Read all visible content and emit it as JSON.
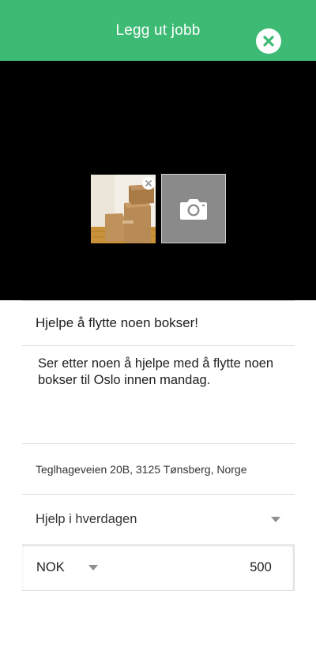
{
  "header": {
    "title": "Legg ut jobb",
    "background_color": "#3dba73",
    "close_icon": "close-circle-icon"
  },
  "photos": {
    "thumbnail_alt": "Moving boxes photo",
    "remove_icon": "remove-x-icon",
    "camera_icon": "camera-icon"
  },
  "form": {
    "title_value": "Hjelpe å flytte noen bokser!",
    "description_value": "Ser etter noen å hjelpe med å flytte noen bokser til Oslo innen mandag.",
    "address_value": "Teglhageveien 20B, 3125 Tønsberg, Norge",
    "category_value": "Hjelp i hverdagen",
    "currency_value": "NOK",
    "price_value": "500"
  }
}
